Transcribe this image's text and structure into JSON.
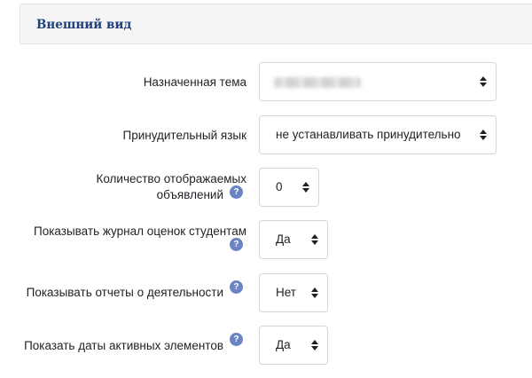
{
  "section": {
    "title": "Внешний вид"
  },
  "fields": {
    "theme": {
      "label": "Назначенная тема",
      "value": ""
    },
    "language": {
      "label": "Принудительный язык",
      "value": "не устанавливать принудительно"
    },
    "news_count": {
      "label_line1": "Количество отображаемых",
      "label_line2": "объявлений",
      "value": "0"
    },
    "gradebook": {
      "label": "Показывать журнал оценок студентам",
      "value": "Да"
    },
    "activity_reports": {
      "label": "Показывать отчеты о деятельности",
      "value": "Нет"
    },
    "activity_dates": {
      "label": "Показать даты активных элементов",
      "value": "Да"
    }
  },
  "help_symbol": "?"
}
